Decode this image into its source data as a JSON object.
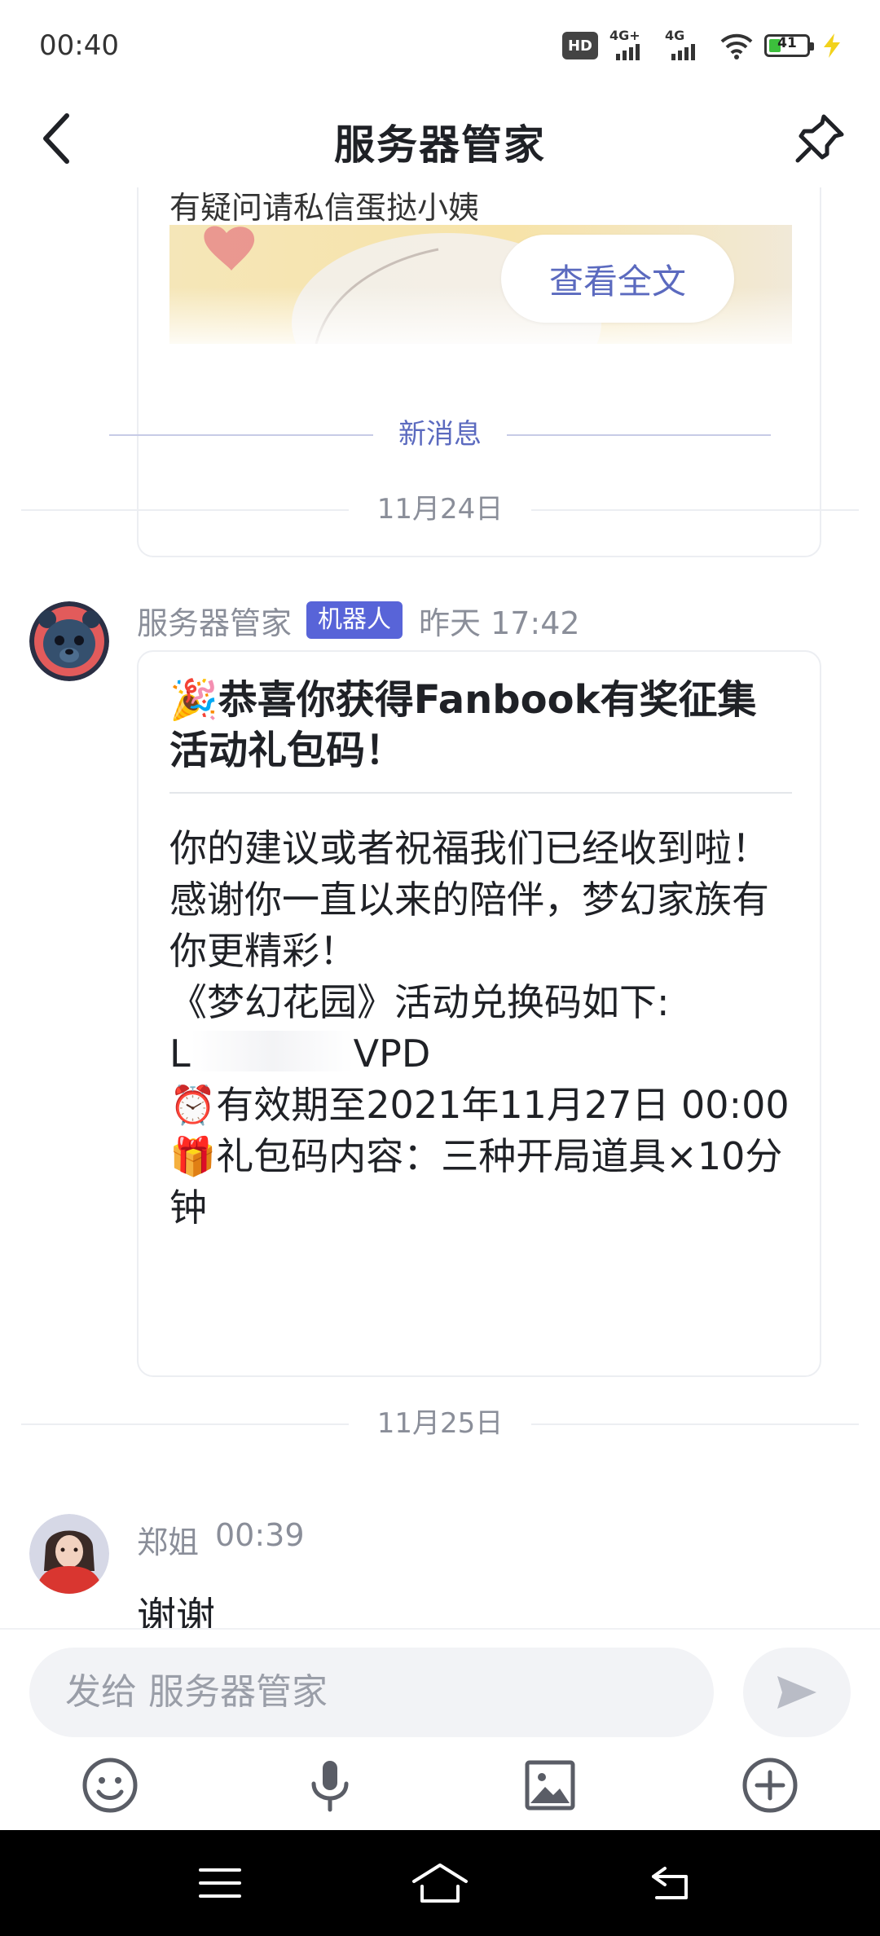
{
  "status_bar": {
    "time": "00:40",
    "hd_label": "HD",
    "sim1_label": "4G+",
    "sim2_label": "4G",
    "battery_level": "41"
  },
  "header": {
    "title": "服务器管家"
  },
  "prev_card": {
    "text": "有疑问请私信蛋挞小姨",
    "button_label": "查看全文"
  },
  "new_messages_label": "新消息",
  "dates": {
    "first": "11月24日",
    "second": "11月25日"
  },
  "bot_message": {
    "sender": "服务器管家",
    "badge": "机器人",
    "time": "昨天 17:42",
    "title_emoji": "🎉",
    "title": "恭喜你获得Fanbook有奖征集活动礼包码！",
    "line1": "你的建议或者祝福我们已经收到啦！",
    "line2": "感谢你一直以来的陪伴，梦幻家族有你更精彩！",
    "line3": "《梦幻花园》活动兑换码如下:",
    "code_prefix": "L",
    "code_suffix": "VPD",
    "expiry_emoji": "⏰",
    "expiry": "有效期至2021年11月27日 00:00",
    "gift_emoji": "🎁",
    "gift": "礼包码内容：三种开局道具×10分钟"
  },
  "user_message": {
    "sender": "郑姐",
    "time": "00:39",
    "text": "谢谢"
  },
  "input": {
    "placeholder": "发给 服务器管家"
  },
  "toolbar": {
    "emoji_icon": "smile-icon",
    "voice_icon": "microphone-icon",
    "image_icon": "image-icon",
    "more_icon": "plus-circle-icon"
  },
  "colors": {
    "accent": "#5b6abf",
    "bot_badge": "#5864d8",
    "nav_bar": "#000000"
  }
}
